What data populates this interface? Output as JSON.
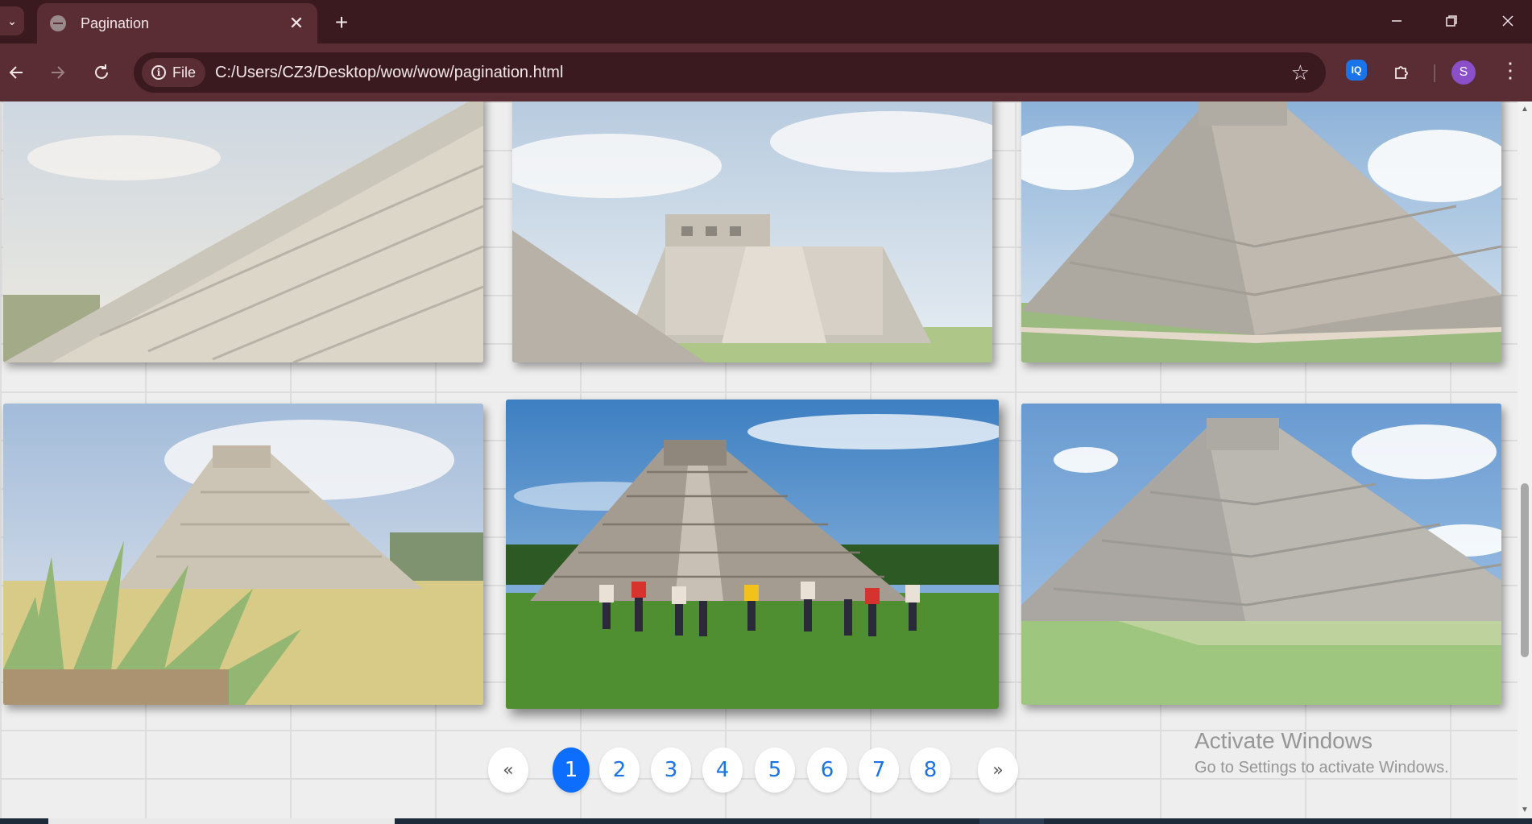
{
  "browser": {
    "tab_title": "Pagination",
    "tab_close": "✕",
    "new_tab": "+",
    "site_chip_label": "File",
    "url": "C:/Users/CZ3/Desktop/wow/wow/pagination.html",
    "profile_initial": "S",
    "ext_label": "IQ"
  },
  "pagination": {
    "prev": "«",
    "next": "»",
    "pages": [
      "1",
      "2",
      "3",
      "4",
      "5",
      "6",
      "7",
      "8"
    ],
    "active_page": "1"
  },
  "watermark": {
    "line1": "Activate Windows",
    "line2": "Go to Settings to activate Windows."
  },
  "icons": {
    "tab_menu": "chevron-down-icon",
    "back": "back-arrow-icon",
    "forward": "forward-arrow-icon",
    "reload": "reload-icon",
    "bookmark": "star-icon",
    "extensions": "puzzle-icon",
    "menu": "kebab-menu-icon"
  },
  "colors": {
    "chrome_dark": "#3a1a1f",
    "chrome_light": "#5a2c33",
    "active_page": "#0d6efd",
    "page_link": "#1a73e8"
  }
}
